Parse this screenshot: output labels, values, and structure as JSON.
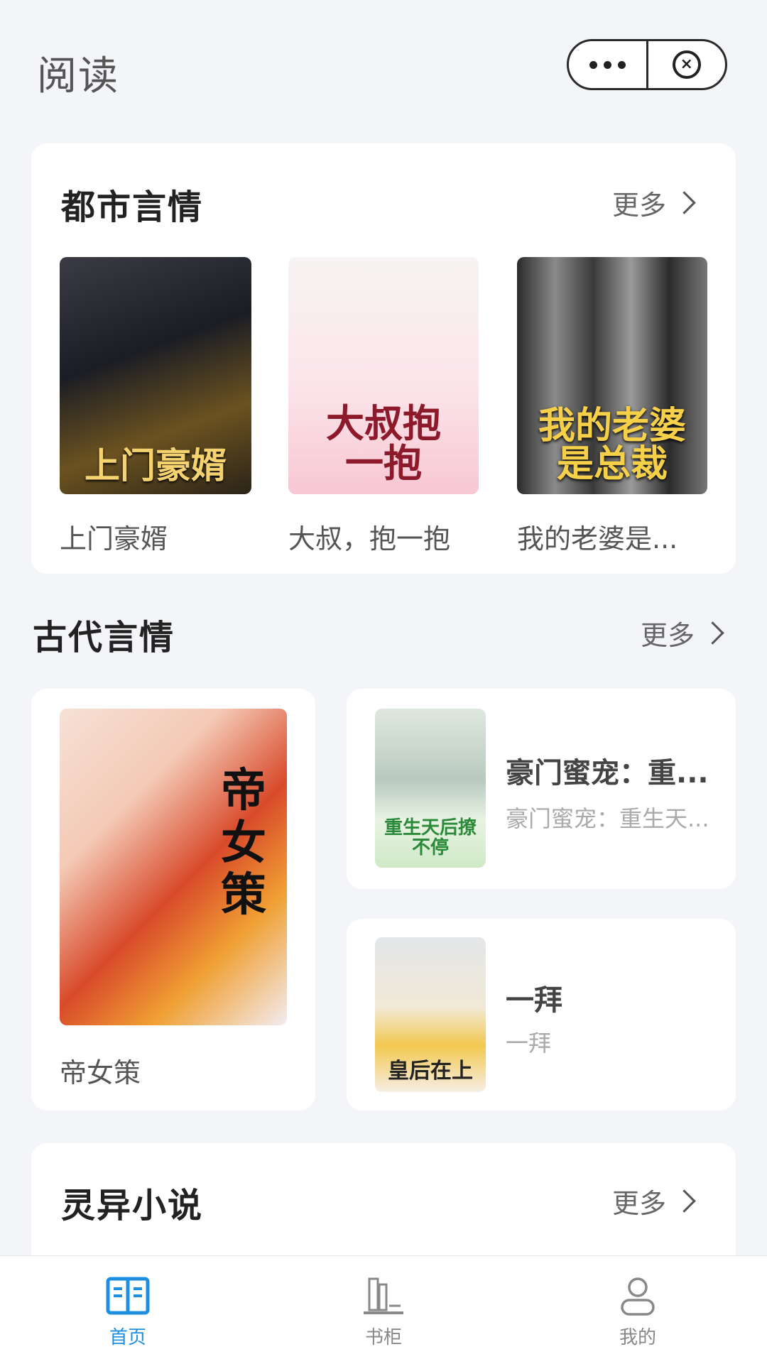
{
  "header": {
    "title": "阅读"
  },
  "sections": {
    "urban": {
      "title": "都市言情",
      "more": "更多",
      "books": [
        {
          "name": "上门豪婿",
          "cover_text": "上门豪婿"
        },
        {
          "name": "大叔，抱一抱",
          "cover_text": "大叔抱一抱"
        },
        {
          "name": "我的老婆是...",
          "cover_text": "我的老婆是总裁"
        }
      ]
    },
    "ancient": {
      "title": "古代言情",
      "more": "更多",
      "feature": {
        "name": "帝女策",
        "cover_text": "帝女策"
      },
      "list": [
        {
          "title": "豪门蜜宠：重...",
          "subtitle": "豪门蜜宠：重生天...",
          "cover_text": "重生天后撩不停"
        },
        {
          "title": "一拜",
          "subtitle": "一拜",
          "cover_text": "皇后在上"
        }
      ]
    },
    "supernatural": {
      "title": "灵异小说",
      "more": "更多"
    }
  },
  "tabbar": {
    "items": [
      {
        "label": "首页",
        "icon": "book-open-icon",
        "active": true
      },
      {
        "label": "书柜",
        "icon": "bookshelf-icon",
        "active": false
      },
      {
        "label": "我的",
        "icon": "person-icon",
        "active": false
      }
    ]
  },
  "colors": {
    "accent": "#1e8fe0",
    "inactive": "#888888",
    "background": "#f4f5f9"
  }
}
